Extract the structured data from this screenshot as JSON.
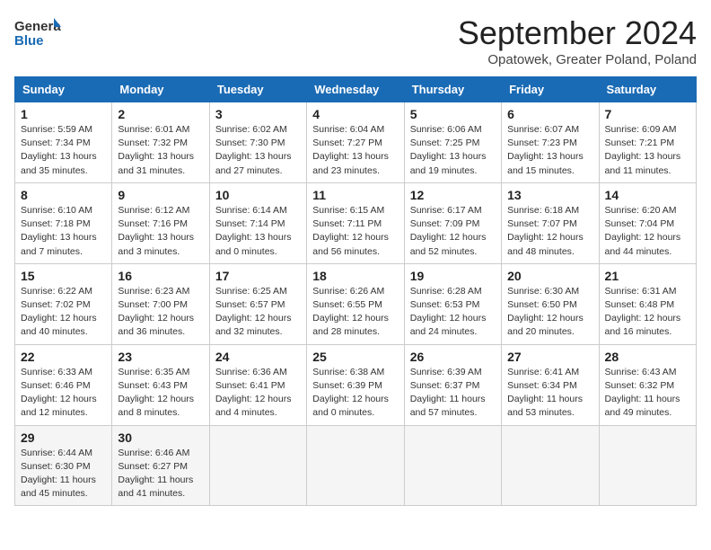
{
  "header": {
    "logo_line1": "General",
    "logo_line2": "Blue",
    "month_year": "September 2024",
    "location": "Opatowek, Greater Poland, Poland"
  },
  "weekdays": [
    "Sunday",
    "Monday",
    "Tuesday",
    "Wednesday",
    "Thursday",
    "Friday",
    "Saturday"
  ],
  "weeks": [
    [
      {
        "day": "1",
        "rise": "Sunrise: 5:59 AM",
        "set": "Sunset: 7:34 PM",
        "daylight": "Daylight: 13 hours and 35 minutes."
      },
      {
        "day": "2",
        "rise": "Sunrise: 6:01 AM",
        "set": "Sunset: 7:32 PM",
        "daylight": "Daylight: 13 hours and 31 minutes."
      },
      {
        "day": "3",
        "rise": "Sunrise: 6:02 AM",
        "set": "Sunset: 7:30 PM",
        "daylight": "Daylight: 13 hours and 27 minutes."
      },
      {
        "day": "4",
        "rise": "Sunrise: 6:04 AM",
        "set": "Sunset: 7:27 PM",
        "daylight": "Daylight: 13 hours and 23 minutes."
      },
      {
        "day": "5",
        "rise": "Sunrise: 6:06 AM",
        "set": "Sunset: 7:25 PM",
        "daylight": "Daylight: 13 hours and 19 minutes."
      },
      {
        "day": "6",
        "rise": "Sunrise: 6:07 AM",
        "set": "Sunset: 7:23 PM",
        "daylight": "Daylight: 13 hours and 15 minutes."
      },
      {
        "day": "7",
        "rise": "Sunrise: 6:09 AM",
        "set": "Sunset: 7:21 PM",
        "daylight": "Daylight: 13 hours and 11 minutes."
      }
    ],
    [
      {
        "day": "8",
        "rise": "Sunrise: 6:10 AM",
        "set": "Sunset: 7:18 PM",
        "daylight": "Daylight: 13 hours and 7 minutes."
      },
      {
        "day": "9",
        "rise": "Sunrise: 6:12 AM",
        "set": "Sunset: 7:16 PM",
        "daylight": "Daylight: 13 hours and 3 minutes."
      },
      {
        "day": "10",
        "rise": "Sunrise: 6:14 AM",
        "set": "Sunset: 7:14 PM",
        "daylight": "Daylight: 13 hours and 0 minutes."
      },
      {
        "day": "11",
        "rise": "Sunrise: 6:15 AM",
        "set": "Sunset: 7:11 PM",
        "daylight": "Daylight: 12 hours and 56 minutes."
      },
      {
        "day": "12",
        "rise": "Sunrise: 6:17 AM",
        "set": "Sunset: 7:09 PM",
        "daylight": "Daylight: 12 hours and 52 minutes."
      },
      {
        "day": "13",
        "rise": "Sunrise: 6:18 AM",
        "set": "Sunset: 7:07 PM",
        "daylight": "Daylight: 12 hours and 48 minutes."
      },
      {
        "day": "14",
        "rise": "Sunrise: 6:20 AM",
        "set": "Sunset: 7:04 PM",
        "daylight": "Daylight: 12 hours and 44 minutes."
      }
    ],
    [
      {
        "day": "15",
        "rise": "Sunrise: 6:22 AM",
        "set": "Sunset: 7:02 PM",
        "daylight": "Daylight: 12 hours and 40 minutes."
      },
      {
        "day": "16",
        "rise": "Sunrise: 6:23 AM",
        "set": "Sunset: 7:00 PM",
        "daylight": "Daylight: 12 hours and 36 minutes."
      },
      {
        "day": "17",
        "rise": "Sunrise: 6:25 AM",
        "set": "Sunset: 6:57 PM",
        "daylight": "Daylight: 12 hours and 32 minutes."
      },
      {
        "day": "18",
        "rise": "Sunrise: 6:26 AM",
        "set": "Sunset: 6:55 PM",
        "daylight": "Daylight: 12 hours and 28 minutes."
      },
      {
        "day": "19",
        "rise": "Sunrise: 6:28 AM",
        "set": "Sunset: 6:53 PM",
        "daylight": "Daylight: 12 hours and 24 minutes."
      },
      {
        "day": "20",
        "rise": "Sunrise: 6:30 AM",
        "set": "Sunset: 6:50 PM",
        "daylight": "Daylight: 12 hours and 20 minutes."
      },
      {
        "day": "21",
        "rise": "Sunrise: 6:31 AM",
        "set": "Sunset: 6:48 PM",
        "daylight": "Daylight: 12 hours and 16 minutes."
      }
    ],
    [
      {
        "day": "22",
        "rise": "Sunrise: 6:33 AM",
        "set": "Sunset: 6:46 PM",
        "daylight": "Daylight: 12 hours and 12 minutes."
      },
      {
        "day": "23",
        "rise": "Sunrise: 6:35 AM",
        "set": "Sunset: 6:43 PM",
        "daylight": "Daylight: 12 hours and 8 minutes."
      },
      {
        "day": "24",
        "rise": "Sunrise: 6:36 AM",
        "set": "Sunset: 6:41 PM",
        "daylight": "Daylight: 12 hours and 4 minutes."
      },
      {
        "day": "25",
        "rise": "Sunrise: 6:38 AM",
        "set": "Sunset: 6:39 PM",
        "daylight": "Daylight: 12 hours and 0 minutes."
      },
      {
        "day": "26",
        "rise": "Sunrise: 6:39 AM",
        "set": "Sunset: 6:37 PM",
        "daylight": "Daylight: 11 hours and 57 minutes."
      },
      {
        "day": "27",
        "rise": "Sunrise: 6:41 AM",
        "set": "Sunset: 6:34 PM",
        "daylight": "Daylight: 11 hours and 53 minutes."
      },
      {
        "day": "28",
        "rise": "Sunrise: 6:43 AM",
        "set": "Sunset: 6:32 PM",
        "daylight": "Daylight: 11 hours and 49 minutes."
      }
    ],
    [
      {
        "day": "29",
        "rise": "Sunrise: 6:44 AM",
        "set": "Sunset: 6:30 PM",
        "daylight": "Daylight: 11 hours and 45 minutes."
      },
      {
        "day": "30",
        "rise": "Sunrise: 6:46 AM",
        "set": "Sunset: 6:27 PM",
        "daylight": "Daylight: 11 hours and 41 minutes."
      },
      null,
      null,
      null,
      null,
      null
    ]
  ]
}
